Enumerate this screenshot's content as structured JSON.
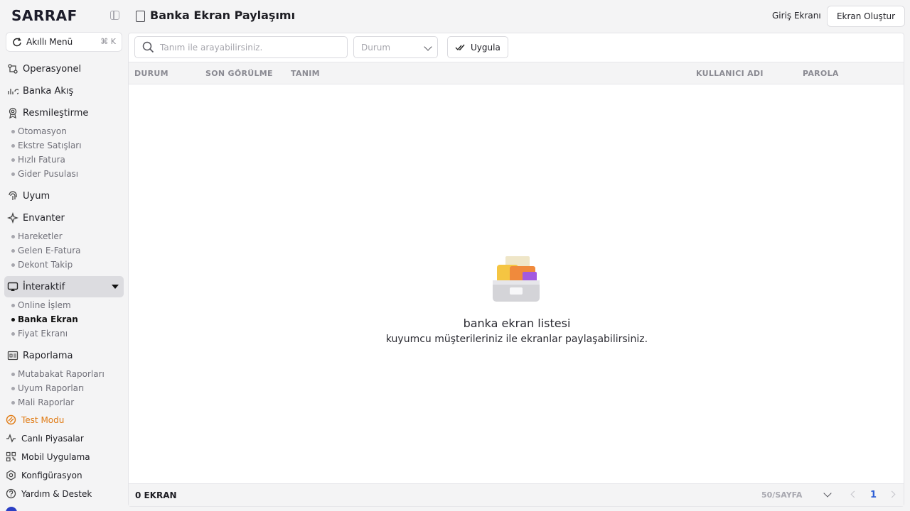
{
  "brand": "SARRAF",
  "smart_menu": {
    "label": "Akıllı Menü",
    "shortcut": "⌘ K"
  },
  "sidebar": {
    "operasyonel": "Operasyonel",
    "banka_akis": "Banka Akış",
    "resmilestirme": "Resmileştirme",
    "resmilestirme_items": [
      "Otomasyon",
      "Ekstre Satışları",
      "Hızlı Fatura",
      "Gider Pusulası"
    ],
    "uyum": "Uyum",
    "envanter": "Envanter",
    "envanter_items": [
      "Hareketler",
      "Gelen E-Fatura",
      "Dekont Takip"
    ],
    "interaktif": "İnteraktif",
    "interaktif_items": [
      "Online İşlem",
      "Banka Ekran",
      "Fiyat Ekranı"
    ],
    "raporlama": "Raporlama",
    "raporlama_items": [
      "Mutabakat Raporları",
      "Uyum Raporları",
      "Mali Raporlar"
    ],
    "bottom": [
      "Test Modu",
      "Canlı Piyasalar",
      "Mobil Uygulama",
      "Konfigürasyon",
      "Yardım & Destek"
    ]
  },
  "header": {
    "title": "Banka Ekran Paylaşımı",
    "login_link": "Giriş Ekranı",
    "create_button": "Ekran Oluştur"
  },
  "filters": {
    "search_placeholder": "Tanım ile arayabilirsiniz.",
    "status_placeholder": "Durum",
    "apply_label": "Uygula"
  },
  "table": {
    "columns": [
      "DURUM",
      "SON GÖRÜLME",
      "TANIM",
      "KULLANICI ADI",
      "PAROLA"
    ],
    "rows": []
  },
  "empty_state": {
    "title": "banka ekran listesi",
    "subtitle": "kuyumcu müşterileriniz ile ekranlar paylaşabilirsiniz."
  },
  "footer": {
    "count": "0 EKRAN",
    "per_page": "50/SAYFA",
    "current_page": "1"
  },
  "colors": {
    "accent": "#2e5fd6",
    "test_mode": "#e07a12",
    "active_bg": "#dcdce0"
  }
}
